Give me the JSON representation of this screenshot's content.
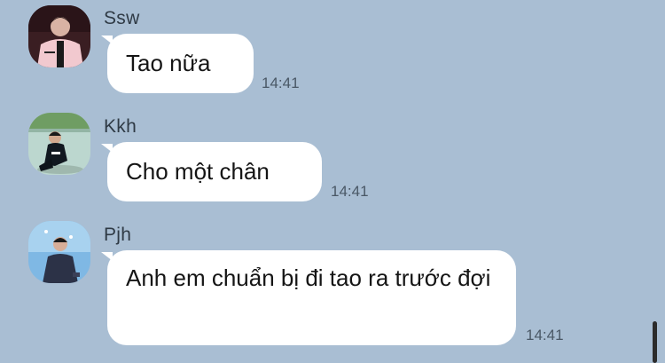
{
  "messages": [
    {
      "sender": "Ssw",
      "text": "Tao nữa",
      "time": "14:41",
      "avatar_icon": "avatar-photo-pink-jacket"
    },
    {
      "sender": "Kkh",
      "text": "Cho một chân",
      "time": "14:41",
      "avatar_icon": "avatar-photo-outdoor-crouching"
    },
    {
      "sender": "Pjh",
      "text": "Anh em chuẩn bị đi tao ra trước đợi",
      "time": "14:41",
      "avatar_icon": "avatar-photo-blue-stage"
    }
  ],
  "colors": {
    "background": "#a9bed3",
    "bubble": "#ffffff",
    "text": "#151515",
    "timestamp": "#4a5866"
  }
}
